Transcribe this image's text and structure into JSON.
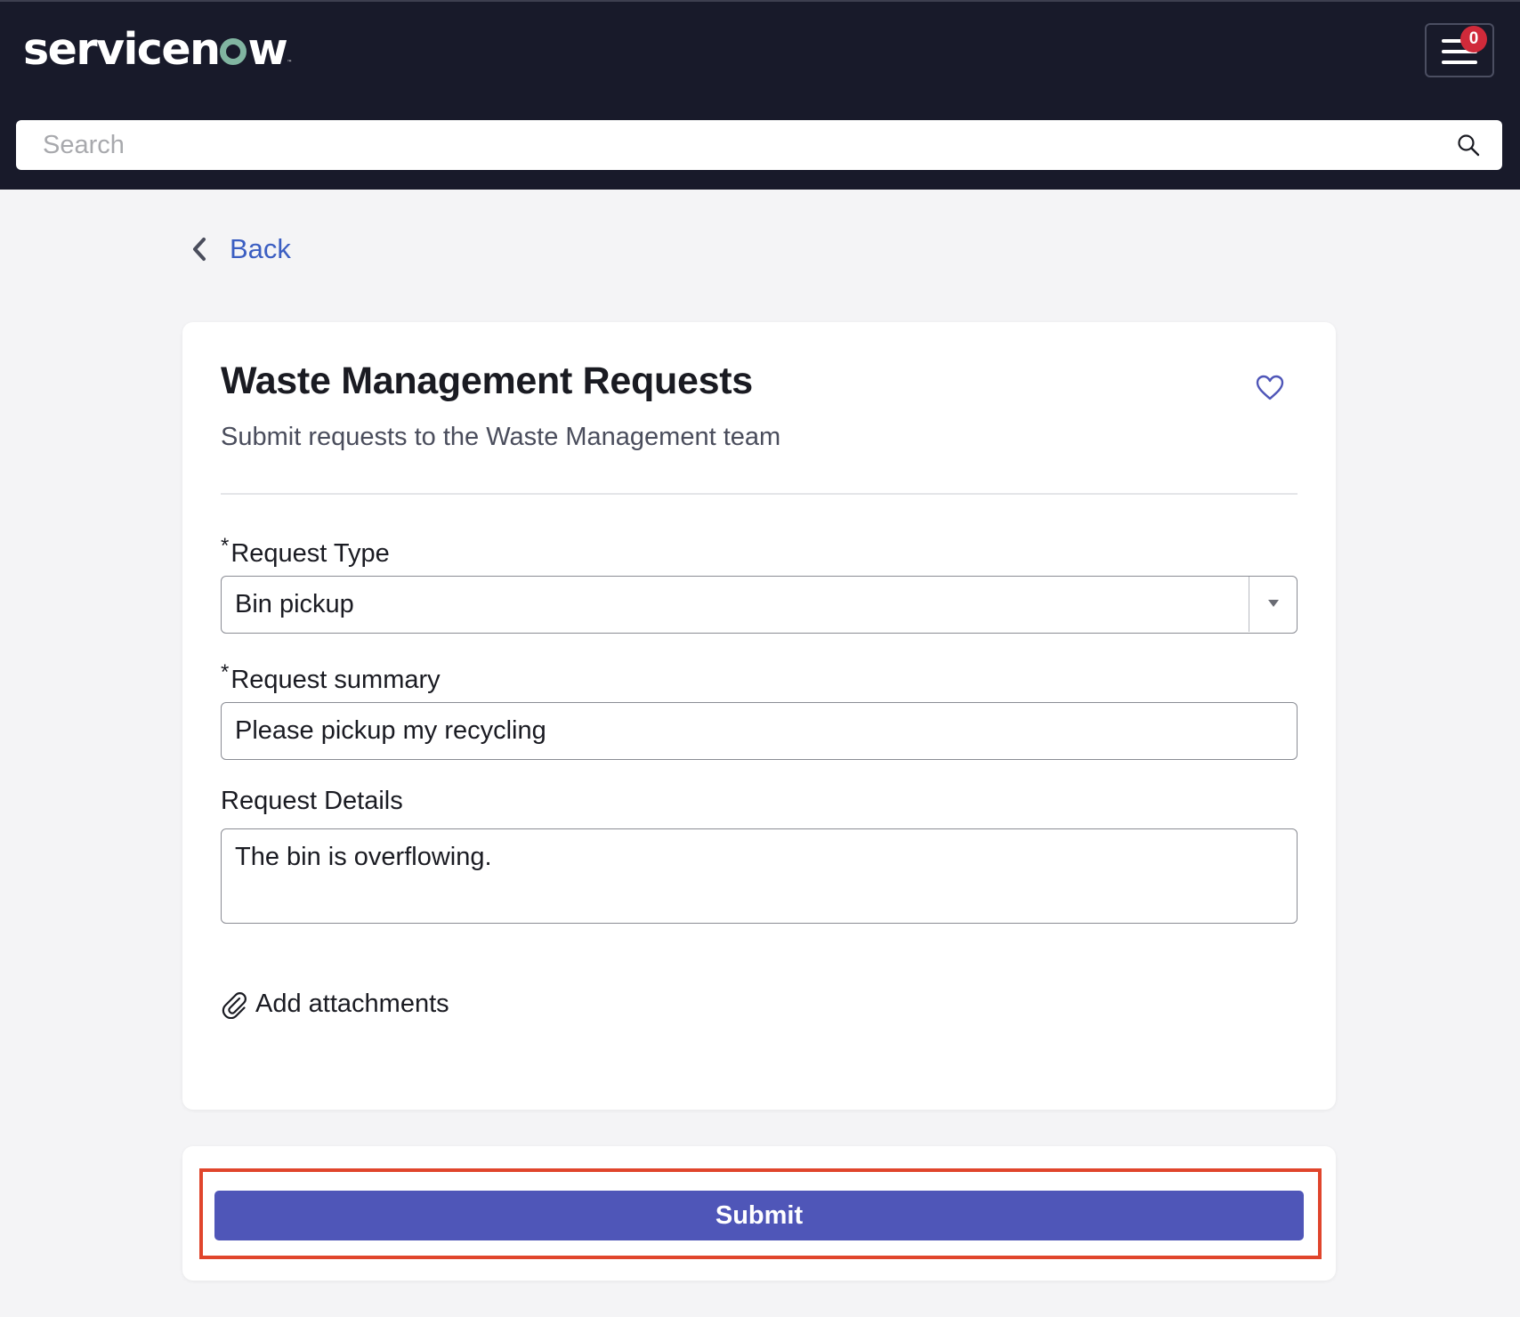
{
  "header": {
    "logo_text_before": "servicen",
    "logo_text_after": "w",
    "logo_trademark": "™",
    "notification_count": "0",
    "search_placeholder": "Search",
    "colors": {
      "header_bg": "#181a2a",
      "logo_accent": "#81b5a1",
      "badge": "#d02a3a"
    }
  },
  "nav": {
    "back_label": "Back"
  },
  "form": {
    "title": "Waste Management Requests",
    "subtitle": "Submit requests to the Waste Management team",
    "required_marker": "*",
    "request_type": {
      "label": "Request Type",
      "selected_value": "Bin pickup"
    },
    "request_summary": {
      "label": "Request summary",
      "value": "Please pickup my recycling"
    },
    "request_details": {
      "label": "Request Details",
      "value": "The bin is overflowing."
    },
    "attachments_label": "Add attachments"
  },
  "actions": {
    "submit_label": "Submit",
    "colors": {
      "submit_bg": "#4f56b8",
      "highlight_border": "#e0452c"
    }
  },
  "icons": {
    "menu": "hamburger-icon",
    "search": "search-icon",
    "back": "chevron-left-icon",
    "favorite": "heart-icon",
    "attachment": "paperclip-icon",
    "dropdown": "caret-down-icon"
  }
}
